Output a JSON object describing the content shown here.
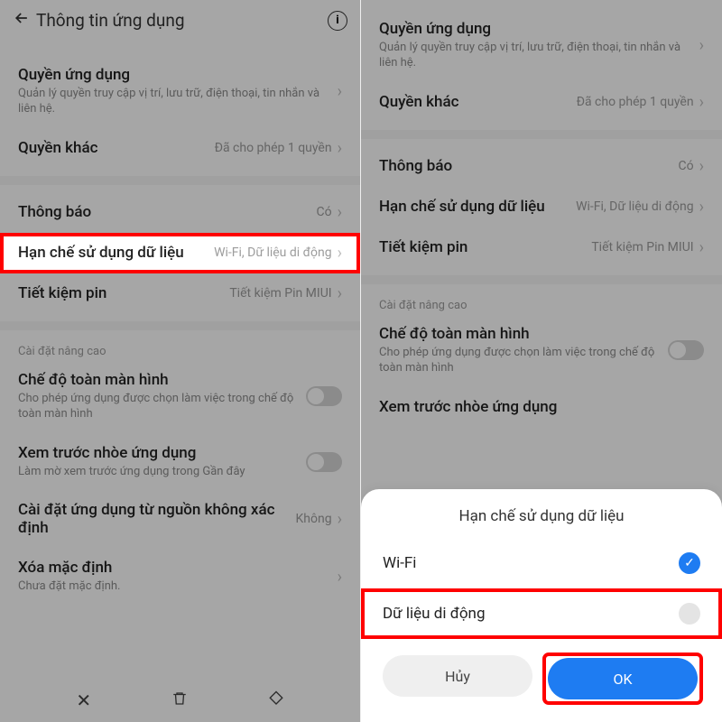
{
  "left": {
    "header": {
      "title": "Thông tin ứng dụng"
    },
    "rows": {
      "permissions": {
        "label": "Quyền ứng dụng",
        "sub": "Quản lý quyền truy cập vị trí, lưu trữ, điện thoại, tin nhắn và liên hệ."
      },
      "other_perm": {
        "label": "Quyền khác",
        "value": "Đã cho phép 1 quyền"
      },
      "notif": {
        "label": "Thông báo",
        "value": "Có"
      },
      "data": {
        "label": "Hạn chế sử dụng dữ liệu",
        "value": "Wi-Fi, Dữ liệu di động"
      },
      "battery": {
        "label": "Tiết kiệm pin",
        "value": "Tiết kiệm Pin MIUI"
      },
      "advanced_title": "Cài đặt nâng cao",
      "fullscreen": {
        "label": "Chế độ toàn màn hình",
        "sub": "Cho phép ứng dụng được chọn làm việc trong chế độ toàn màn hình"
      },
      "blur": {
        "label": "Xem trước nhòe ứng dụng",
        "sub": "Làm mờ xem trước ứng dụng trong Gần đây"
      },
      "unknown": {
        "label": "Cài đặt ứng dụng từ nguồn không xác định",
        "value": "Không"
      },
      "clear": {
        "label": "Xóa mặc định",
        "sub": "Chưa đặt mặc định."
      }
    }
  },
  "right": {
    "rows": {
      "permissions": {
        "label": "Quyền ứng dụng",
        "sub": "Quản lý quyền truy cập vị trí, lưu trữ, điện thoại, tin nhắn và liên hệ."
      },
      "other_perm": {
        "label": "Quyền khác",
        "value": "Đã cho phép 1 quyền"
      },
      "notif": {
        "label": "Thông báo",
        "value": "Có"
      },
      "data": {
        "label": "Hạn chế sử dụng dữ liệu",
        "value": "Wi-Fi, Dữ liệu di động"
      },
      "battery": {
        "label": "Tiết kiệm pin",
        "value": "Tiết kiệm Pin MIUI"
      },
      "advanced_title": "Cài đặt nâng cao",
      "fullscreen": {
        "label": "Chế độ toàn màn hình",
        "sub": "Cho phép ứng dụng được chọn làm việc trong chế độ toàn màn hình"
      },
      "blur": {
        "label": "Xem trước nhòe ứng dụng"
      }
    },
    "sheet": {
      "title": "Hạn chế sử dụng dữ liệu",
      "wifi": "Wi-Fi",
      "mobile": "Dữ liệu di động",
      "cancel": "Hủy",
      "ok": "OK"
    }
  }
}
